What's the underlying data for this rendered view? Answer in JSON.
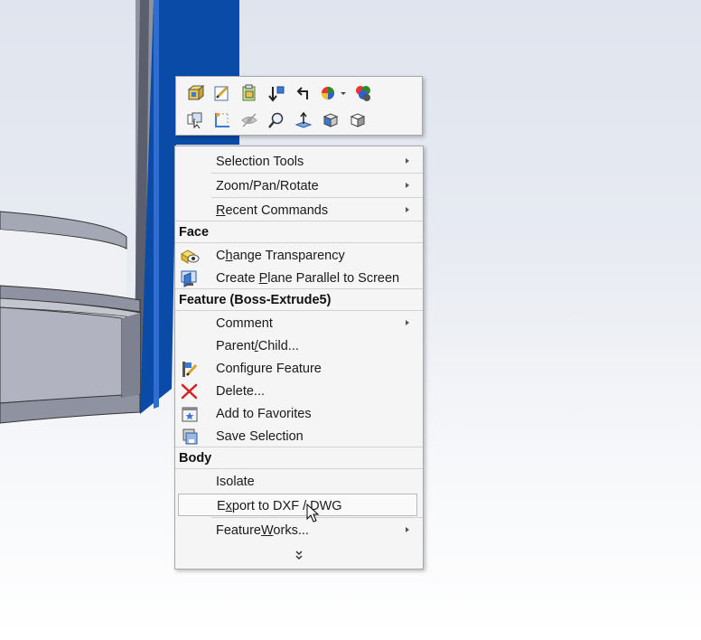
{
  "toolbar": {
    "row1": [
      "zoom-to-selection-icon",
      "edit-sketch-icon",
      "paste-feature-icon",
      "rollback-icon",
      "undo-arrow-icon",
      "appearance-icon",
      "dropdown-caret-icon",
      "display-states-icon"
    ],
    "row2": [
      "select-other-icon",
      "sketch-corner-icon",
      "hide-body-icon",
      "zoom-icon",
      "normal-to-icon",
      "isometric-view-icon",
      "view-orientation-icon"
    ]
  },
  "menu": {
    "top": [
      {
        "pre": "Selection Tools",
        "u": "",
        "post": ""
      },
      {
        "pre": "Zoom/Pan/Rotate",
        "u": "",
        "post": ""
      },
      {
        "pre": "",
        "u": "R",
        "post": "ecent Commands"
      }
    ],
    "face_header": "Face",
    "face_items": [
      {
        "pre": "C",
        "u": "h",
        "post": "ange Transparency"
      },
      {
        "pre": "Create ",
        "u": "P",
        "post": "lane Parallel to Screen"
      }
    ],
    "feature_header": "Feature (Boss-Extrude5)",
    "feature_items": [
      {
        "pre": "Comment",
        "u": "",
        "post": ""
      },
      {
        "pre": "Parent",
        "u": "/",
        "post": "Child..."
      },
      {
        "pre": "Configure Feature",
        "u": "",
        "post": ""
      },
      {
        "pre": "Delete...",
        "u": "",
        "post": ""
      },
      {
        "pre": "Add to Favorites",
        "u": "",
        "post": ""
      },
      {
        "pre": "Save Selection",
        "u": "",
        "post": ""
      }
    ],
    "body_header": "Body",
    "body_items": [
      {
        "pre": "Isolate",
        "u": "",
        "post": ""
      },
      {
        "pre": "E",
        "u": "x",
        "post": "port to DXF / DWG"
      },
      {
        "pre": "Feature",
        "u": "W",
        "post": "orks..."
      }
    ]
  },
  "colors": {
    "menu_bg": "#f5f5f5",
    "selected_face": "#0a4ba8",
    "model_gray": "#a4a7b4",
    "delete_red": "#d42020"
  }
}
